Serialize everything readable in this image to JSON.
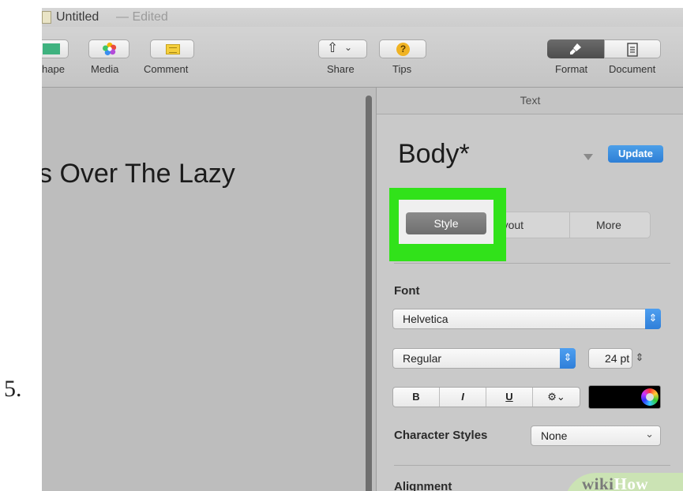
{
  "step_number": "5.",
  "window": {
    "title": "Untitled",
    "title_status": "— Edited"
  },
  "toolbar": {
    "shape_label": "hape",
    "media_label": "Media",
    "comment_label": "Comment",
    "share_label": "Share",
    "tips_label": "Tips",
    "format_label": "Format",
    "document_label": "Document"
  },
  "canvas": {
    "text": "s Over The Lazy"
  },
  "inspector": {
    "header_tab": "Text",
    "paragraph_style": "Body*",
    "update_label": "Update",
    "tabs": [
      "Style",
      "Layout",
      "More"
    ],
    "font_section_label": "Font",
    "font_family": "Helvetica",
    "font_typeface": "Regular",
    "font_size": "24 pt",
    "format_buttons": [
      "B",
      "I",
      "U",
      "⚙⌄"
    ],
    "character_styles_label": "Character Styles",
    "character_styles_value": "None",
    "alignment_label": "Alignment"
  },
  "watermark": {
    "part1": "wiki",
    "part2": "How"
  },
  "colors": {
    "highlight": "#31e21a",
    "update_button": "#2e7fd6",
    "text_color_well": "#000000"
  }
}
